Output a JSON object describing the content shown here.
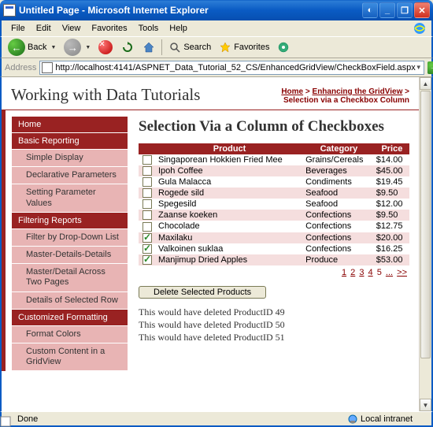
{
  "window": {
    "title": "Untitled Page - Microsoft Internet Explorer"
  },
  "menu": {
    "file": "File",
    "edit": "Edit",
    "view": "View",
    "favorites": "Favorites",
    "tools": "Tools",
    "help": "Help"
  },
  "toolbar": {
    "back": "Back",
    "search": "Search",
    "favorites": "Favorites"
  },
  "address": {
    "label": "Address",
    "url": "http://localhost:4141/ASPNET_Data_Tutorial_52_CS/EnhancedGridView/CheckBoxField.aspx",
    "go": "Go"
  },
  "page": {
    "site_title": "Working with Data Tutorials",
    "breadcrumb": {
      "home": "Home",
      "section": "Enhancing the GridView",
      "current": "Selection via a Checkbox Column"
    },
    "heading": "Selection Via a Column of Checkboxes"
  },
  "nav": {
    "home": "Home",
    "basic_reporting": "Basic Reporting",
    "simple_display": "Simple Display",
    "declarative_parameters": "Declarative Parameters",
    "setting_parameter_values": "Setting Parameter Values",
    "filtering_reports": "Filtering Reports",
    "filter_ddl": "Filter by Drop-Down List",
    "master_details_details": "Master-Details-Details",
    "master_detail_two_pages": "Master/Detail Across Two Pages",
    "details_selected_row": "Details of Selected Row",
    "customized_formatting": "Customized Formatting",
    "format_colors": "Format Colors",
    "custom_content_gridview": "Custom Content in a GridView"
  },
  "grid": {
    "headers": {
      "product": "Product",
      "category": "Category",
      "price": "Price"
    },
    "rows": [
      {
        "checked": false,
        "product": "Singaporean Hokkien Fried Mee",
        "category": "Grains/Cereals",
        "price": "$14.00"
      },
      {
        "checked": false,
        "product": "Ipoh Coffee",
        "category": "Beverages",
        "price": "$45.00"
      },
      {
        "checked": false,
        "product": "Gula Malacca",
        "category": "Condiments",
        "price": "$19.45"
      },
      {
        "checked": false,
        "product": "Rogede sild",
        "category": "Seafood",
        "price": "$9.50"
      },
      {
        "checked": false,
        "product": "Spegesild",
        "category": "Seafood",
        "price": "$12.00"
      },
      {
        "checked": false,
        "product": "Zaanse koeken",
        "category": "Confections",
        "price": "$9.50"
      },
      {
        "checked": false,
        "product": "Chocolade",
        "category": "Confections",
        "price": "$12.75"
      },
      {
        "checked": true,
        "product": "Maxilaku",
        "category": "Confections",
        "price": "$20.00"
      },
      {
        "checked": true,
        "product": "Valkoinen suklaa",
        "category": "Confections",
        "price": "$16.25"
      },
      {
        "checked": true,
        "product": "Manjimup Dried Apples",
        "category": "Produce",
        "price": "$53.00"
      }
    ],
    "pager": {
      "p1": "1",
      "p2": "2",
      "p3": "3",
      "p4": "4",
      "p5": "5",
      "ellipsis": "...",
      "next": ">>"
    }
  },
  "actions": {
    "delete_btn": "Delete Selected Products"
  },
  "output": {
    "line1": "This would have deleted ProductID 49",
    "line2": "This would have deleted ProductID 50",
    "line3": "This would have deleted ProductID 51"
  },
  "status": {
    "done": "Done",
    "zone": "Local intranet"
  }
}
